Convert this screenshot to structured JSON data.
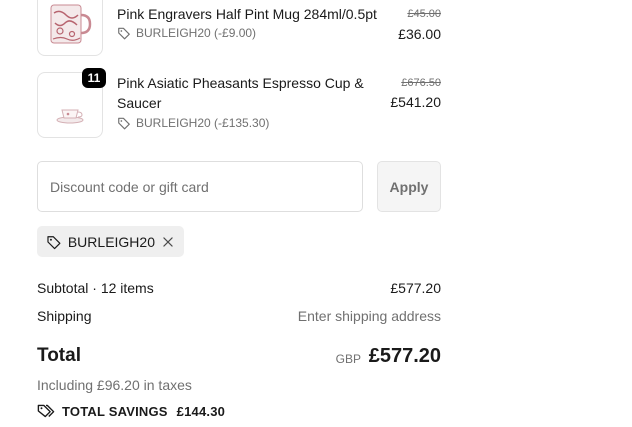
{
  "items": [
    {
      "name_lines": [
        "Pink Engravers Half Pint Mug 284ml/0.5pt"
      ],
      "discount": "BURLEIGH20 (-£9.00)",
      "original_price": "£45.00",
      "price": "£36.00",
      "quantity": ""
    },
    {
      "name_lines": [
        "Pink Asiatic Pheasants Espresso Cup &",
        "Saucer"
      ],
      "discount": "BURLEIGH20 (-£135.30)",
      "original_price": "£676.50",
      "price": "£541.20",
      "quantity": "11"
    }
  ],
  "discount_form": {
    "placeholder": "Discount code or gift card",
    "apply_label": "Apply"
  },
  "applied_code": "BURLEIGH20",
  "summary": {
    "subtotal_label": "Subtotal · 12 items",
    "subtotal_value": "£577.20",
    "shipping_label": "Shipping",
    "shipping_value": "Enter shipping address",
    "total_label": "Total",
    "currency": "GBP",
    "total_value": "£577.20",
    "taxes_text": "Including £96.20 in taxes",
    "savings_label": "TOTAL SAVINGS",
    "savings_value": "£144.30"
  },
  "colors": {
    "badge": "#000000",
    "muted_text": "#707070",
    "border": "#dedede",
    "chip_bg": "#efefef",
    "mug_pattern": "#b7646f"
  }
}
